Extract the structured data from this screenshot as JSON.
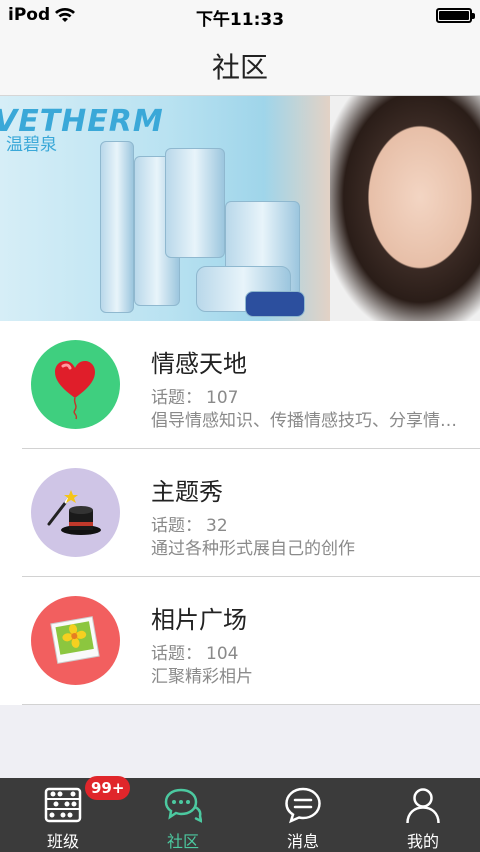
{
  "status_bar": {
    "carrier": "iPod",
    "time": "下午11:33"
  },
  "nav": {
    "title": "社区"
  },
  "banner": {
    "brand": "VETHERM",
    "brand_cn": "温碧泉"
  },
  "communities": [
    {
      "name": "情感天地",
      "topics_label": "话题：",
      "topics_count": "107",
      "description": "倡导情感知识、传播情感技巧、分享情感经历",
      "icon": "heart-balloon-icon",
      "color": "#3fcf7f"
    },
    {
      "name": "主题秀",
      "topics_label": "话题：",
      "topics_count": "32",
      "description": "通过各种形式展自己的创作",
      "icon": "magic-hat-icon",
      "color": "#cfc5e6"
    },
    {
      "name": "相片广场",
      "topics_label": "话题：",
      "topics_count": "104",
      "description": "汇聚精彩相片",
      "icon": "photo-icon",
      "color": "#f25f5f"
    }
  ],
  "tab_bar": {
    "accent_color": "#4cc9a0",
    "tabs": [
      {
        "label": "班级",
        "icon": "class-abacus-icon",
        "badge": "99+"
      },
      {
        "label": "社区",
        "icon": "chat-bubbles-icon",
        "active": true
      },
      {
        "label": "消息",
        "icon": "message-bubble-icon"
      },
      {
        "label": "我的",
        "icon": "person-icon"
      }
    ]
  }
}
